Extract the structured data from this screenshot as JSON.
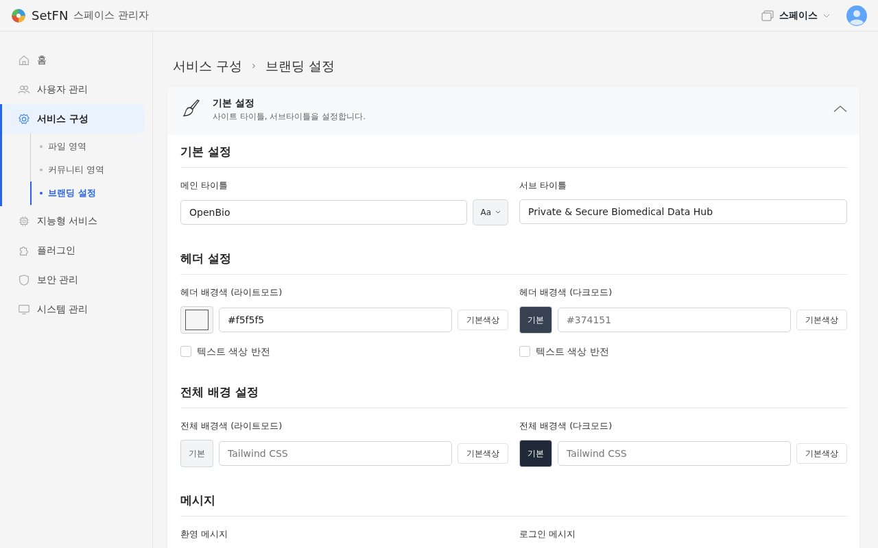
{
  "header": {
    "brand": "SetFN",
    "subtitle": "스페이스 관리자",
    "space_menu": "스페이스"
  },
  "sidebar": {
    "items": [
      {
        "label": "홈",
        "selected": false
      },
      {
        "label": "사용자 관리",
        "selected": false
      },
      {
        "label": "서비스 구성",
        "selected": true,
        "expanded": true,
        "children": [
          {
            "label": "파일 영역",
            "selected": false
          },
          {
            "label": "커뮤니티 영역",
            "selected": false
          },
          {
            "label": "브랜딩 설정",
            "selected": true
          }
        ]
      },
      {
        "label": "지능형 서비스",
        "selected": false
      },
      {
        "label": "플러그인",
        "selected": false
      },
      {
        "label": "보안 관리",
        "selected": false
      },
      {
        "label": "시스템 관리",
        "selected": false
      }
    ]
  },
  "breadcrumb": {
    "items": [
      "서비스 구성",
      "브랜딩 설정"
    ],
    "separator": "›"
  },
  "panel": {
    "title": "기본 설정",
    "description": "사이트 타이틀, 서브타이틀을 설정합니다.",
    "expanded": true,
    "sections": [
      {
        "title": "기본 설정",
        "fields": [
          {
            "kind": "text",
            "label": "메인 타이틀",
            "value": "OpenBio",
            "font_button": "Aa"
          },
          {
            "kind": "text",
            "label": "서브 타이틀",
            "value": "Private & Secure Biomedical Data Hub"
          }
        ]
      },
      {
        "title": "헤더 설정",
        "fields": [
          {
            "kind": "color",
            "label": "헤더 배경색 (라이트모드)",
            "swatch": {
              "color": "#f5f5f5"
            },
            "value": "#f5f5f5",
            "reset": "기본색상",
            "checkbox": {
              "label": "텍스트 색상 반전",
              "checked": false
            }
          },
          {
            "kind": "color",
            "label": "헤더 배경색 (다크모드)",
            "swatch": {
              "color": "#374151",
              "text": "기본"
            },
            "placeholder": "#374151",
            "reset": "기본색상",
            "checkbox": {
              "label": "텍스트 색상 반전",
              "checked": false
            }
          }
        ]
      },
      {
        "title": "전체 배경 설정",
        "fields": [
          {
            "kind": "color",
            "label": "전체 배경색 (라이트모드)",
            "swatch": {
              "color": "#f3f4f6",
              "text": "기본"
            },
            "placeholder": "Tailwind CSS",
            "reset": "기본색상"
          },
          {
            "kind": "color",
            "label": "전체 배경색 (다크모드)",
            "swatch": {
              "color": "#1f2937",
              "text": "기본"
            },
            "placeholder": "Tailwind CSS",
            "reset": "기본색상"
          }
        ]
      },
      {
        "title": "메시지",
        "fields": [
          {
            "kind": "textarea",
            "label": "환영 메시지"
          },
          {
            "kind": "textarea",
            "label": "로그인 메시지"
          }
        ]
      }
    ]
  }
}
